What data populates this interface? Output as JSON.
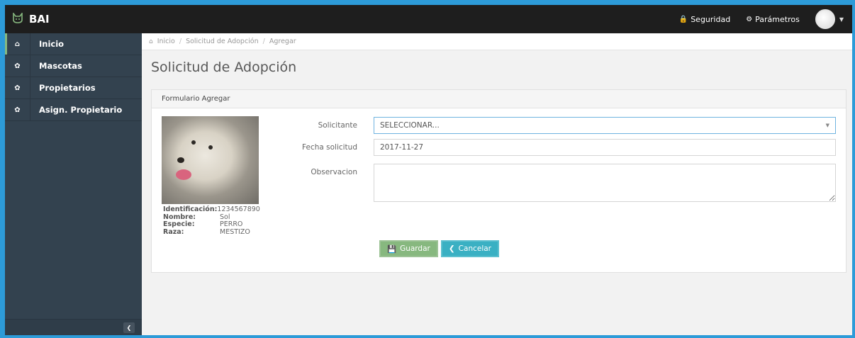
{
  "navbar": {
    "brand": "BAI",
    "brand_icon": "cat-icon",
    "links": [
      {
        "label": "Seguridad",
        "icon": "lock-icon"
      },
      {
        "label": "Parámetros",
        "icon": "cogs-icon"
      }
    ]
  },
  "sidebar": {
    "items": [
      {
        "label": "Inicio",
        "icon": "home-icon",
        "active": true
      },
      {
        "label": "Mascotas",
        "icon": "paw-icon",
        "active": false
      },
      {
        "label": "Propietarios",
        "icon": "paw-icon",
        "active": false
      },
      {
        "label": "Asign. Propietario",
        "icon": "paw-icon",
        "active": false
      }
    ]
  },
  "breadcrumb": [
    "Inicio",
    "Solicitud de Adopción",
    "Agregar"
  ],
  "page_title": "Solicitud de Adopción",
  "panel": {
    "title": "Formulario Agregar"
  },
  "pet": {
    "id_label": "Identificación:",
    "id_value": "1234567890",
    "name_label": "Nombre:",
    "name_value": "Sol",
    "species_label": "Especie:",
    "species_value": "PERRO",
    "breed_label": "Raza:",
    "breed_value": "MESTIZO"
  },
  "form": {
    "solicitante_label": "Solicitante",
    "solicitante_value": "SELECCIONAR...",
    "fecha_label": "Fecha solicitud",
    "fecha_value": "2017-11-27",
    "observacion_label": "Observacion",
    "observacion_value": ""
  },
  "buttons": {
    "save": "Guardar",
    "cancel": "Cancelar"
  },
  "colors": {
    "navbar_bg": "#1e1e1e",
    "sidebar_bg": "#33424f",
    "save_btn": "#87b87f",
    "cancel_btn": "#3ab0c3"
  }
}
